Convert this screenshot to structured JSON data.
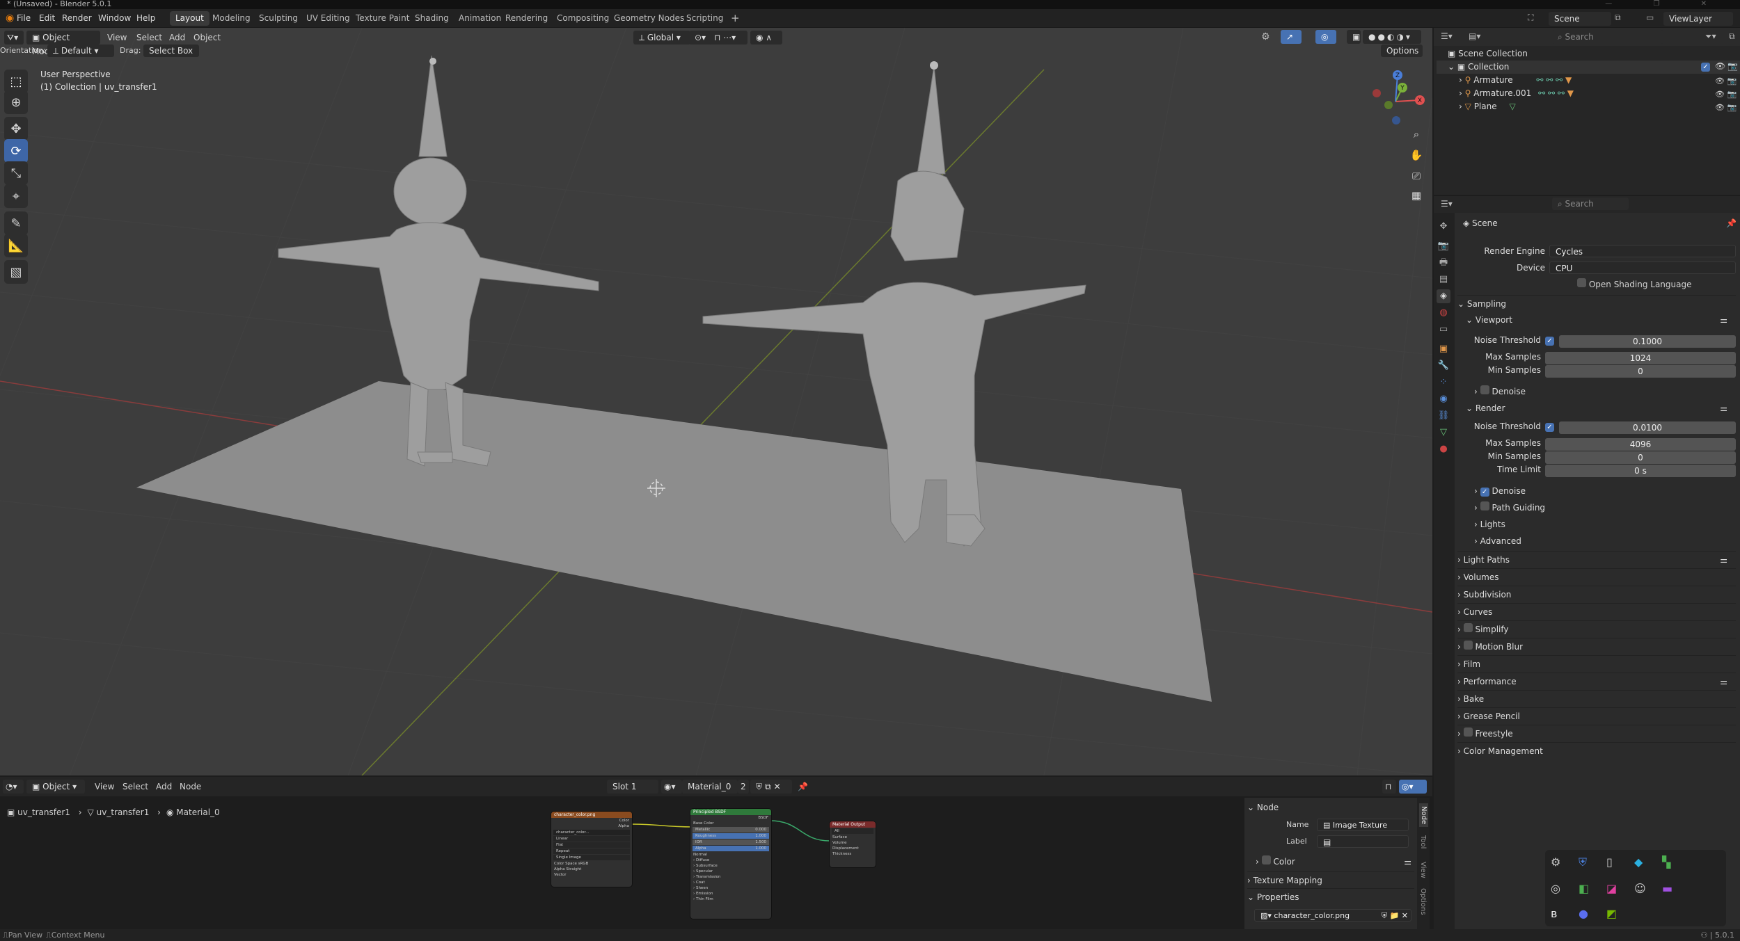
{
  "window": {
    "title": "* (Unsaved) - Blender 5.0.1"
  },
  "menubar": [
    "File",
    "Edit",
    "Render",
    "Window",
    "Help"
  ],
  "workspaces": [
    "Layout",
    "Modeling",
    "Sculpting",
    "UV Editing",
    "Texture Paint",
    "Shading",
    "Animation",
    "Rendering",
    "Compositing",
    "Geometry Nodes",
    "Scripting"
  ],
  "active_workspace": "Layout",
  "scene_selector": "Scene",
  "viewlayer_selector": "ViewLayer",
  "viewport_header": {
    "mode": "Object Mode",
    "menus": [
      "View",
      "Select",
      "Add",
      "Object"
    ],
    "transform_orientation": "Global",
    "orientation_label": "Orientation:",
    "orientation_value": "Default",
    "drag_label": "Drag:",
    "drag_value": "Select Box",
    "options": "Options"
  },
  "viewport": {
    "perspective": "User Perspective",
    "collection_info": "(1) Collection | uv_transfer1",
    "gizmo_axes": [
      "X",
      "Y",
      "Z"
    ]
  },
  "outliner": {
    "search_placeholder": "Search",
    "root": "Scene Collection",
    "collection": "Collection",
    "items": [
      "Armature",
      "Armature.001",
      "Plane"
    ]
  },
  "properties": {
    "search_placeholder": "Search",
    "context": "Scene",
    "render_engine_label": "Render Engine",
    "render_engine": "Cycles",
    "device_label": "Device",
    "device": "CPU",
    "osl_label": "Open Shading Language",
    "sampling": "Sampling",
    "viewport_sub": "Viewport",
    "vp_noise_label": "Noise Threshold",
    "vp_noise": "0.1000",
    "vp_max_label": "Max Samples",
    "vp_max": "1024",
    "vp_min_label": "Min Samples",
    "vp_min": "0",
    "vp_denoise": "Denoise",
    "render_sub": "Render",
    "r_noise_label": "Noise Threshold",
    "r_noise": "0.0100",
    "r_max_label": "Max Samples",
    "r_max": "4096",
    "r_min_label": "Min Samples",
    "r_min": "0",
    "r_time_label": "Time Limit",
    "r_time": "0 s",
    "r_denoise": "Denoise",
    "path_guiding": "Path Guiding",
    "lights": "Lights",
    "advanced": "Advanced",
    "panels": [
      "Light Paths",
      "Volumes",
      "Subdivision",
      "Curves",
      "Simplify",
      "Motion Blur",
      "Film",
      "Performance",
      "Bake",
      "Grease Pencil",
      "Freestyle",
      "Color Management"
    ]
  },
  "node_editor": {
    "type": "Object",
    "menus": [
      "View",
      "Select",
      "Add",
      "Node"
    ],
    "slot": "Slot 1",
    "material": "Material_0",
    "users": "2",
    "breadcrumb": [
      "uv_transfer1",
      "uv_transfer1",
      "Material_0"
    ],
    "nodes": {
      "image": {
        "title": "character_color.png",
        "out_color": "Color",
        "out_alpha": "Alpha",
        "file": "character_color...",
        "rows": [
          "Linear",
          "Flat",
          "Repeat",
          "Single Image"
        ],
        "colorspace_label": "Color Space",
        "colorspace": "sRGB",
        "alpha_label": "Alpha",
        "alpha": "Straight",
        "vector": "Vector"
      },
      "bsdf": {
        "title": "Principled BSDF",
        "out": "BSDF",
        "base_color": "Base Color",
        "sliders": [
          [
            "Metallic",
            "0.000"
          ],
          [
            "Roughness",
            "1.000"
          ],
          [
            "IOR",
            "1.500"
          ],
          [
            "Alpha",
            "1.000"
          ]
        ],
        "normal": "Normal",
        "subs": [
          "Diffuse",
          "Subsurface",
          "Specular",
          "Transmission",
          "Coat",
          "Sheen",
          "Emission",
          "Thin Film"
        ]
      },
      "output": {
        "title": "Material Output",
        "target": "All",
        "inputs": [
          "Surface",
          "Volume",
          "Displacement",
          "Thickness"
        ]
      }
    }
  },
  "sidebar": {
    "node_panel": "Node",
    "name_label": "Name",
    "name_value": "Image Texture",
    "label_label": "Label",
    "color": "Color",
    "texture_mapping": "Texture Mapping",
    "properties": "Properties",
    "image_name": "character_color.png",
    "tabs": [
      "Node",
      "Tool",
      "View",
      "Options"
    ]
  },
  "statusbar": {
    "left1": "Pan View",
    "left2": "Context Menu",
    "version": "5.0.1"
  }
}
